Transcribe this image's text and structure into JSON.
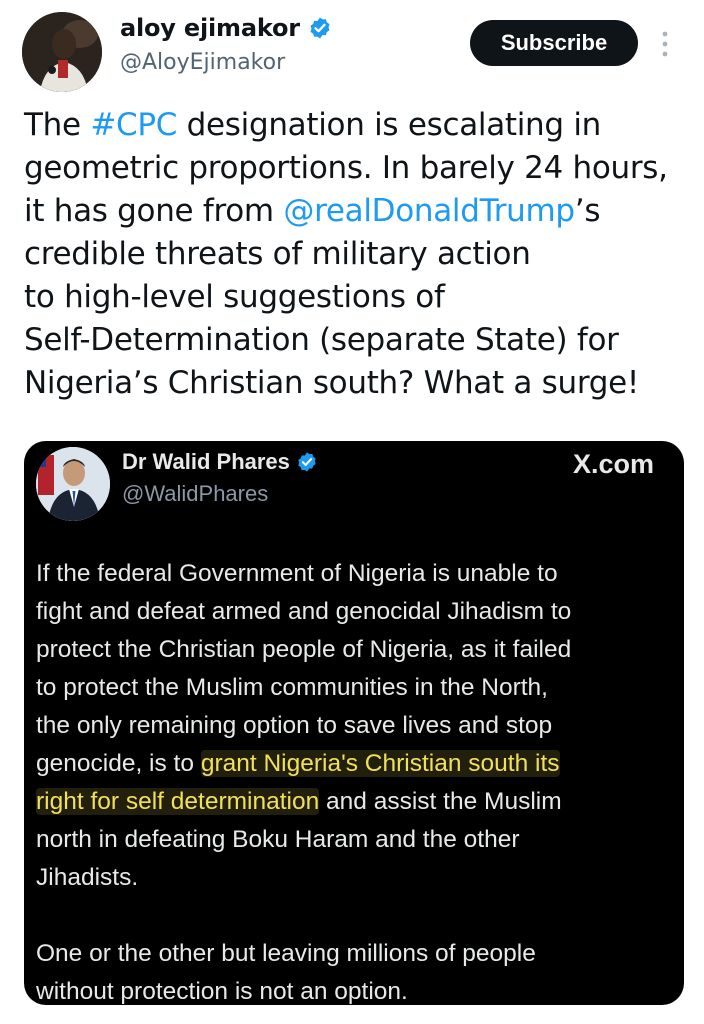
{
  "author": {
    "display_name": "aloy ejimakor",
    "handle": "@AloyEjimakor",
    "verified": true,
    "avatar_icon": "profile-photo"
  },
  "actions": {
    "subscribe_label": "Subscribe",
    "more_icon": "more-vertical-icon"
  },
  "tweet": {
    "lines": [
      [
        {
          "t": "The "
        },
        {
          "t": "#CPC",
          "link": true
        },
        {
          "t": " designation is escalating in"
        }
      ],
      [
        {
          "t": "geometric proportions. In barely 24 hours,"
        }
      ],
      [
        {
          "t": "it has gone from "
        },
        {
          "t": "@realDonaldTrump",
          "link": true
        },
        {
          "t": "’s"
        }
      ],
      [
        {
          "t": "credible threats of military action"
        }
      ],
      [
        {
          "t": "to high-level suggestions of"
        }
      ],
      [
        {
          "t": "Self-Determination (separate State) for"
        }
      ],
      [
        {
          "t": "Nigeria’s Christian south? What a surge!"
        }
      ]
    ]
  },
  "quoted": {
    "display_name": "Dr Walid Phares",
    "handle": "@WalidPhares",
    "verified": true,
    "source": "X.com",
    "paragraphs": [
      [
        [
          {
            "t": "If the federal Government of Nigeria is unable to"
          }
        ],
        [
          {
            "t": "fight and defeat armed and genocidal Jihadism to"
          }
        ],
        [
          {
            "t": "protect the Christian people of Nigeria, as it failed"
          }
        ],
        [
          {
            "t": "to protect the Muslim communities in the North,"
          }
        ],
        [
          {
            "t": "the only remaining option to save lives and stop"
          }
        ],
        [
          {
            "t": "genocide, is to "
          },
          {
            "t": "grant Nigeria's Christian south its",
            "hl": true
          }
        ],
        [
          {
            "t": "right for self determination",
            "hl": true
          },
          {
            "t": " and assist the Muslim"
          }
        ],
        [
          {
            "t": "north in defeating Boku Haram and the other"
          }
        ],
        [
          {
            "t": "Jihadists."
          }
        ]
      ],
      [
        [
          {
            "t": "One or the other but leaving millions of people"
          }
        ],
        [
          {
            "t": "without protection is not an option."
          }
        ]
      ]
    ]
  },
  "colors": {
    "link": "#1d9bf0",
    "highlight": "#f1e05a",
    "card_bg": "#000000"
  }
}
